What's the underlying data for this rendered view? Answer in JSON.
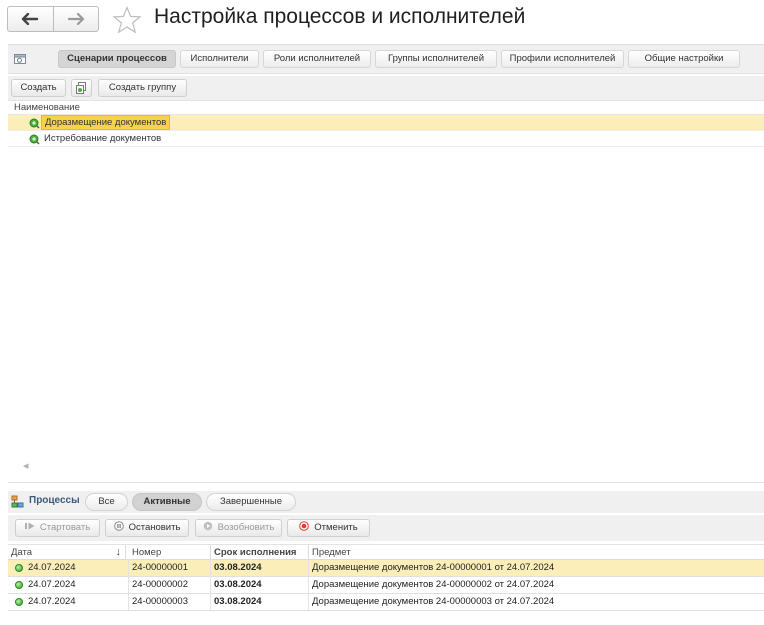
{
  "header": {
    "title": "Настройка процессов и исполнителей"
  },
  "tabs": [
    {
      "label": "Сценарии процессов",
      "active": true
    },
    {
      "label": "Исполнители",
      "active": false
    },
    {
      "label": "Роли исполнителей",
      "active": false
    },
    {
      "label": "Группы исполнителей",
      "active": false
    },
    {
      "label": "Профили исполнителей",
      "active": false
    },
    {
      "label": "Общие настройки",
      "active": false
    }
  ],
  "toolbar": {
    "create_label": "Создать",
    "create_group_label": "Создать группу"
  },
  "scenarios": {
    "column_header": "Наименование",
    "items": [
      {
        "label": "Доразмещение документов",
        "selected": true
      },
      {
        "label": "Истребование документов",
        "selected": false
      }
    ]
  },
  "processes": {
    "title": "Процессы",
    "filters": [
      {
        "label": "Все",
        "active": false
      },
      {
        "label": "Активные",
        "active": true
      },
      {
        "label": "Завершенные",
        "active": false
      }
    ],
    "actions": {
      "start_label": "Стартовать",
      "stop_label": "Остановить",
      "resume_label": "Возобновить",
      "cancel_label": "Отменить"
    },
    "columns": {
      "date": "Дата",
      "sort_indicator": "↓",
      "number": "Номер",
      "deadline": "Срок исполнения",
      "subject": "Предмет"
    },
    "rows": [
      {
        "date": "24.07.2024",
        "number": "24-00000001",
        "deadline": "03.08.2024",
        "subject": "Доразмещение документов 24-00000001 от 24.07.2024",
        "selected": true
      },
      {
        "date": "24.07.2024",
        "number": "24-00000002",
        "deadline": "03.08.2024",
        "subject": "Доразмещение документов 24-00000002 от 24.07.2024",
        "selected": false
      },
      {
        "date": "24.07.2024",
        "number": "24-00000003",
        "deadline": "03.08.2024",
        "subject": "Доразмещение документов 24-00000003 от 24.07.2024",
        "selected": false
      }
    ]
  },
  "colors": {
    "selection": "#fbeeb9",
    "selection_label": "#f5d44c",
    "status_active": "#2f9e26",
    "cancel_red": "#e03a2e"
  },
  "icons": {
    "back": "arrow-left-icon",
    "forward": "arrow-right-icon",
    "favorite": "star-icon",
    "tab_settings": "settings-panel-icon",
    "copy": "copy-document-icon",
    "scenario": "process-scenario-icon",
    "processes": "processes-icon",
    "start": "start-icon",
    "stop": "pause-icon",
    "resume": "resume-icon",
    "cancel": "cancel-record-icon",
    "status": "active-status-icon"
  }
}
